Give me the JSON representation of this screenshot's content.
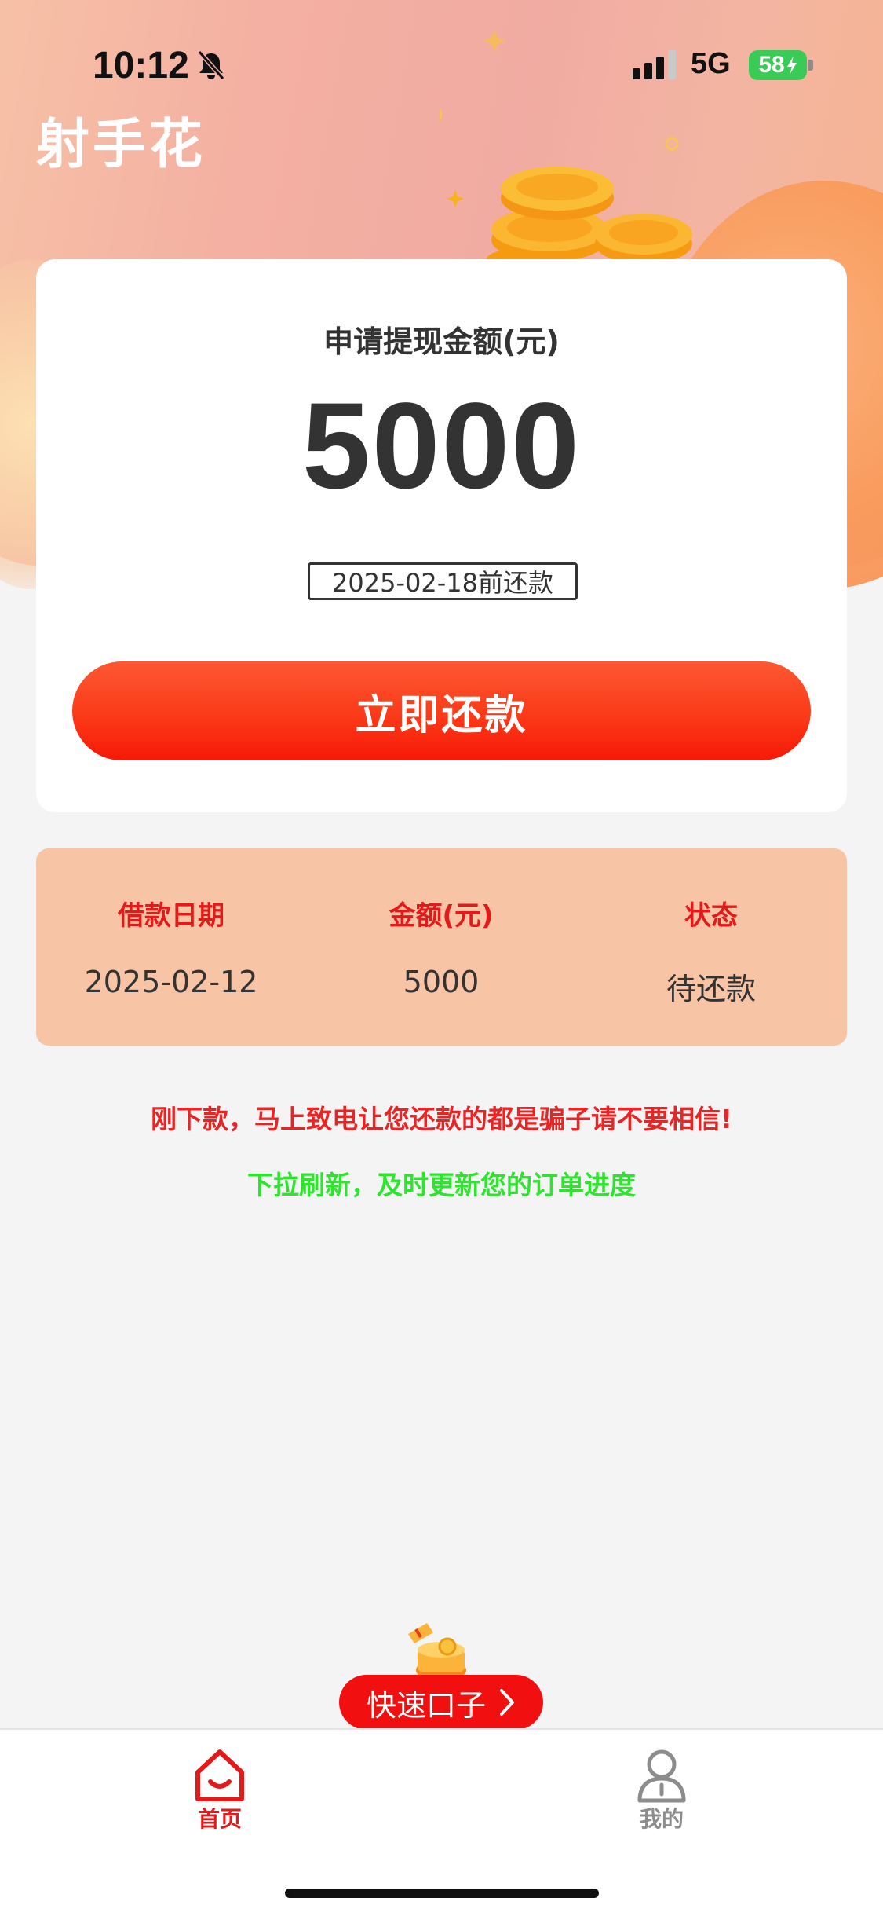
{
  "status_bar": {
    "time": "10:12",
    "network": "5G",
    "battery": "58",
    "icons": [
      "bell-slash-icon",
      "signal-bars-icon",
      "battery-charging-icon"
    ]
  },
  "header": {
    "app_title": "射手花",
    "decoration": "gold-coins-illustration"
  },
  "withdraw_card": {
    "label": "申请提现金额(元)",
    "amount": "5000",
    "due_note": "2025-02-18前还款",
    "repay_button": "立即还款"
  },
  "loan_info": {
    "columns": [
      {
        "header": "借款日期",
        "value": "2025-02-12"
      },
      {
        "header": "金额(元)",
        "value": "5000"
      },
      {
        "header": "状态",
        "value": "待还款"
      }
    ]
  },
  "notices": {
    "warning": "刚下款，马上致电让您还款的都是骗子请不要相信!",
    "refresh_hint": "下拉刷新，及时更新您的订单进度"
  },
  "quick_entry": {
    "label": "快速口子"
  },
  "tabbar": {
    "items": [
      {
        "label": "首页",
        "icon": "home-icon",
        "active": true
      },
      {
        "label": "我的",
        "icon": "user-icon",
        "active": false
      }
    ]
  },
  "colors": {
    "accent_red": "#e41a1a",
    "button_gradient_top": "#fc5833",
    "button_gradient_bottom": "#f71907",
    "info_panel_bg": "#f8c4a6",
    "refresh_green": "#2de52d",
    "header_pink": "#f1aba2"
  }
}
